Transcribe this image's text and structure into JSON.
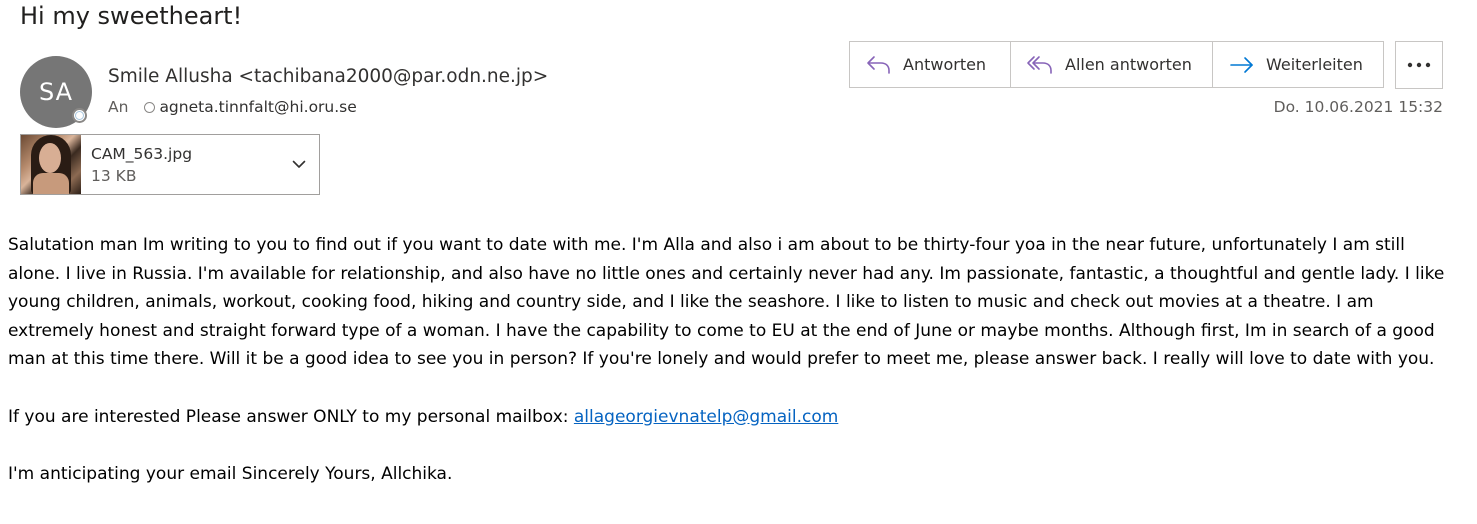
{
  "email": {
    "subject": "Hi my sweetheart!",
    "sender": {
      "initials": "SA",
      "display": "Smile Allusha <tachibana2000@par.odn.ne.jp>"
    },
    "to_label": "An",
    "recipient": "agneta.tinnfalt@hi.oru.se",
    "date": "Do. 10.06.2021 15:32"
  },
  "actions": {
    "reply_label": "Antworten",
    "reply_all_label": "Allen antworten",
    "forward_label": "Weiterleiten",
    "more_icon": "more-horizontal-icon"
  },
  "attachment": {
    "name": "CAM_563.jpg",
    "size": "13 KB"
  },
  "body": {
    "paragraph1": "Salutation man Im writing to you to find out if you want to date with me. I'm Alla and also i am about to be thirty-four yoa in the near future, unfortunately I am still alone. I live in Russia. I'm available for relationship, and also have no little ones and certainly never had any. Im passionate, fantastic, a thoughtful and gentle lady. I like young children, animals, workout, cooking food, hiking and country side, and I like the seashore. I like to listen to music and check out movies at a theatre. I am extremely honest and straight forward type of a woman. I have the capability to come to EU at the end of June or maybe months. Although first, Im in search of a good man at this time there. Will it be a good idea to see you in person? If you're lonely and would prefer to meet me, please answer back. I really will love to date with you.",
    "paragraph2_prefix": "If you are interested Please answer ONLY to my personal mailbox: ",
    "paragraph2_link": "allageorgievnatelp@gmail.com",
    "paragraph3": "I'm anticipating your email Sincerely Yours, Allchika."
  },
  "colors": {
    "reply_icon": "#8764b8",
    "forward_icon": "#0078d4",
    "link": "#0563c1",
    "avatar_bg": "#767676"
  }
}
